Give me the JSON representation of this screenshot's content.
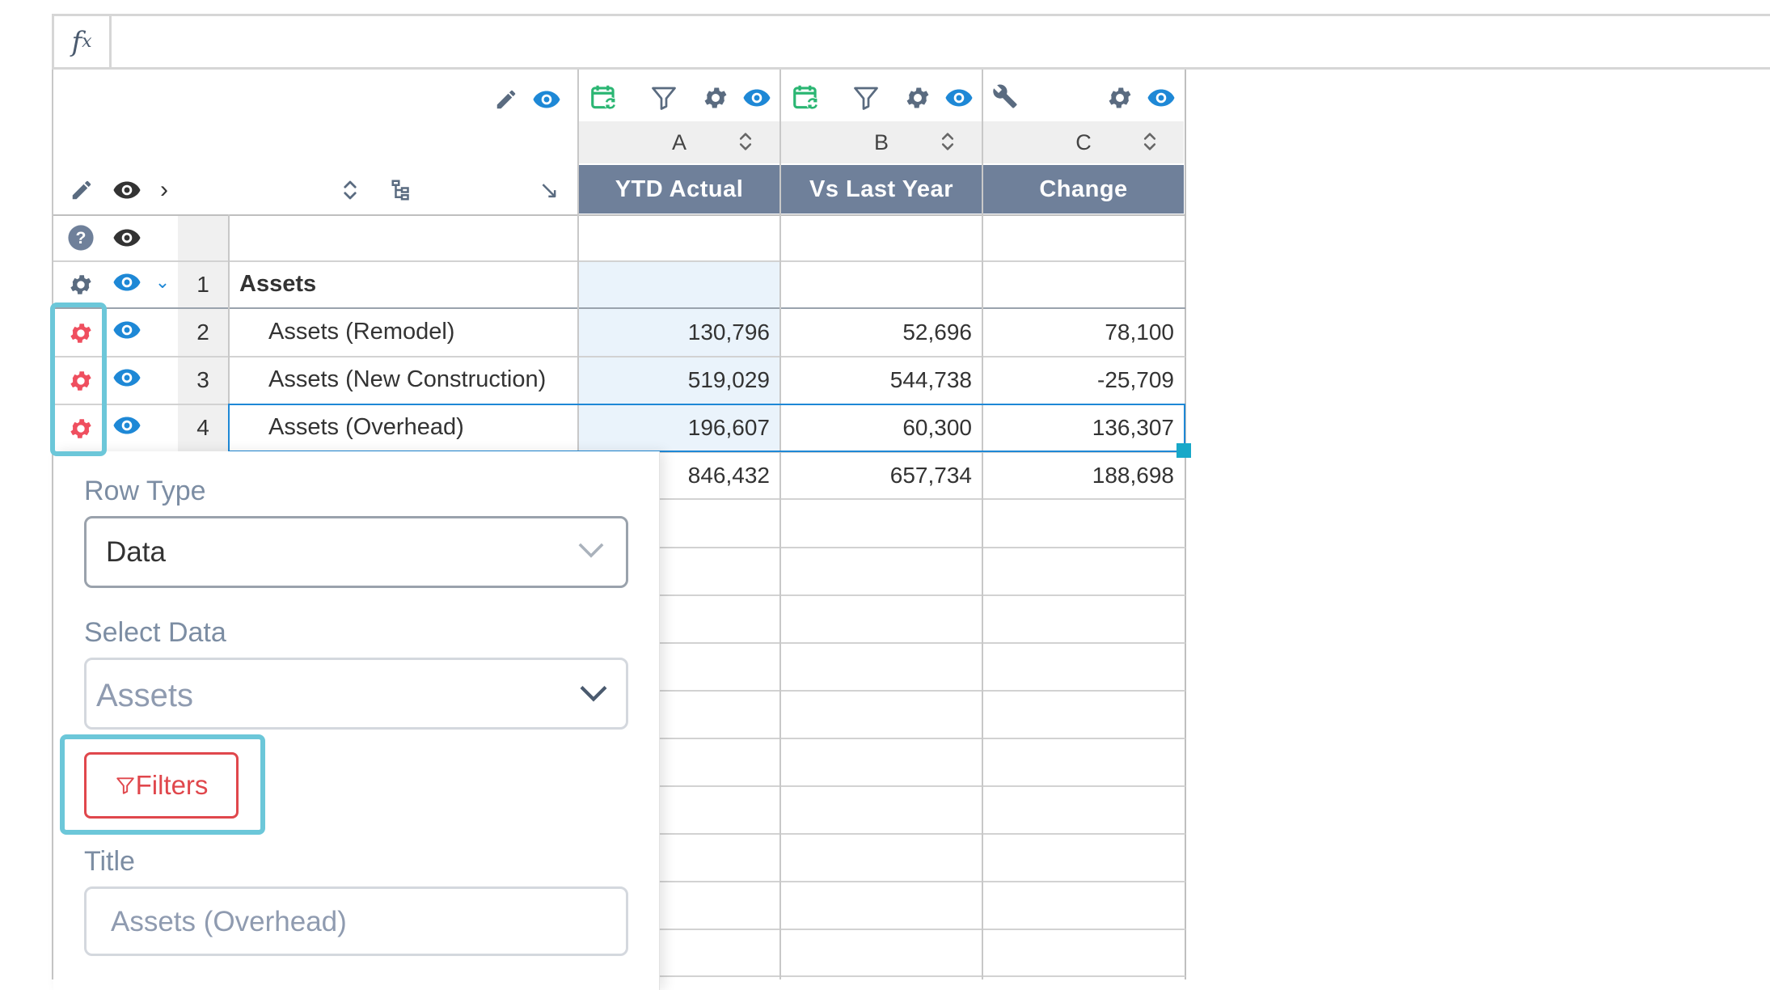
{
  "formula_bar": {
    "fx_symbol": "f",
    "fx_sub": "x",
    "value": ""
  },
  "columns": [
    {
      "letter": "A",
      "title": "YTD Actual"
    },
    {
      "letter": "B",
      "title": "Vs Last Year"
    },
    {
      "letter": "C",
      "title": "Change"
    }
  ],
  "rows": [
    {
      "num": "1",
      "label": "Assets",
      "values": [
        "",
        "",
        ""
      ]
    },
    {
      "num": "2",
      "label": "Assets (Remodel)",
      "values": [
        "130,796",
        "52,696",
        "78,100"
      ]
    },
    {
      "num": "3",
      "label": "Assets (New Construction)",
      "values": [
        "519,029",
        "544,738",
        "-25,709"
      ]
    },
    {
      "num": "4",
      "label": "Assets (Overhead)",
      "values": [
        "196,607",
        "60,300",
        "136,307"
      ]
    }
  ],
  "totals": [
    "846,432",
    "657,734",
    "188,698"
  ],
  "panel": {
    "row_type_label": "Row Type",
    "row_type_value": "Data",
    "select_data_label": "Select Data",
    "select_data_value": "Assets",
    "filters_button": "Filters",
    "title_label": "Title",
    "title_placeholder": "Assets (Overhead)"
  },
  "colors": {
    "accent_blue": "#1e88d6",
    "header_bg": "#6f809a",
    "gear_gray": "#5a6b80",
    "gear_red": "#ef4f5f",
    "calendar_green": "#2bb673",
    "highlight": "#6cc7d9",
    "filters_red": "#e0474c",
    "selection": "#1e88d6"
  }
}
